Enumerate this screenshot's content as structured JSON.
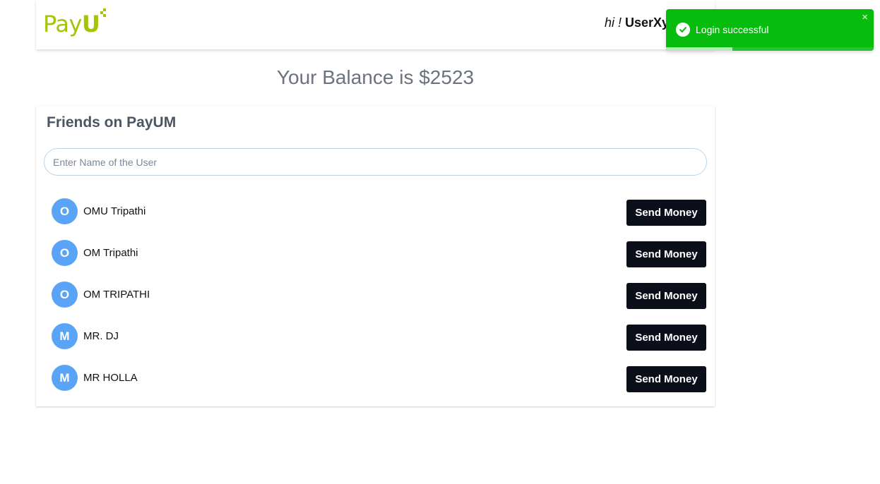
{
  "header": {
    "logo_text": "PayU",
    "logo_text_main": "Pay",
    "logo_text_accent": "U",
    "greeting_prefix": "hi ! ",
    "username": "UserXy"
  },
  "balance": {
    "label": "Your Balance is $2523"
  },
  "friends": {
    "title": "Friends on PayUM",
    "search_placeholder": "Enter Name of the User",
    "search_value": "",
    "send_label": "Send Money",
    "users": [
      {
        "initial": "O",
        "name": "OMU Tripathi"
      },
      {
        "initial": "O",
        "name": "OM Tripathi"
      },
      {
        "initial": "O",
        "name": "OM TRIPATHI"
      },
      {
        "initial": "M",
        "name": "MR. DJ"
      },
      {
        "initial": "M",
        "name": "MR HOLLA"
      }
    ]
  },
  "toast": {
    "message": "Login successful",
    "close_glyph": "×",
    "progress_fraction": 0.32,
    "type": "success",
    "icon": "check-circle-icon"
  },
  "colors": {
    "brand": "#a6c307",
    "avatar": "#5aa4f7",
    "button": "#0b0f19",
    "toast": "#07bc0c"
  }
}
